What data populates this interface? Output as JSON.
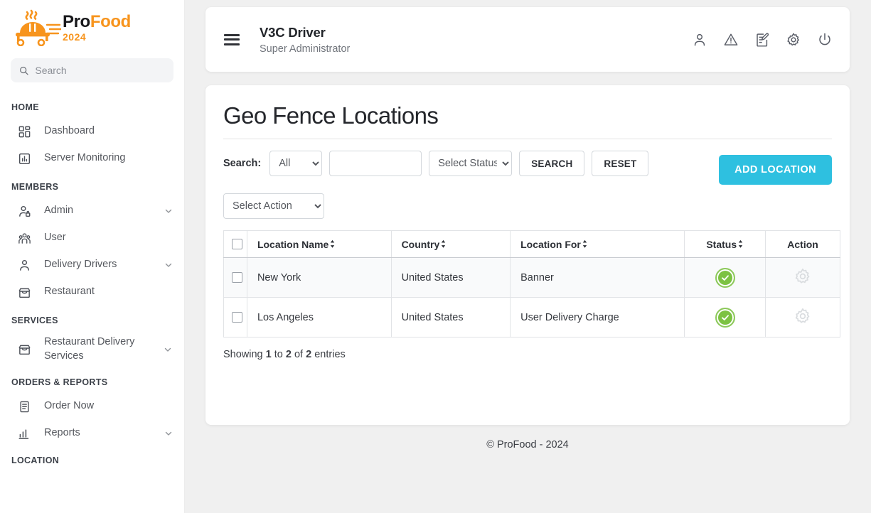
{
  "brand": {
    "name_part1": "Pro",
    "name_part2": "Food",
    "year": "2024",
    "accent_orange": "#f7941d",
    "accent_blue": "#2ec0e0",
    "status_green": "#7cc242"
  },
  "sidebar": {
    "search": {
      "placeholder": "Search",
      "value": "",
      "icon": "search-icon"
    },
    "groups": [
      {
        "section": "HOME",
        "items": [
          {
            "label": "Dashboard",
            "icon": "dashboard-grid-icon",
            "chevron": false
          },
          {
            "label": "Server Monitoring",
            "icon": "bar-chart-icon",
            "chevron": false
          }
        ]
      },
      {
        "section": "MEMBERS",
        "items": [
          {
            "label": "Admin",
            "icon": "user-lock-icon",
            "chevron": true
          },
          {
            "label": "User",
            "icon": "users-group-icon",
            "chevron": false
          },
          {
            "label": "Delivery Drivers",
            "icon": "person-icon",
            "chevron": true
          },
          {
            "label": "Restaurant",
            "icon": "storefront-icon",
            "chevron": false
          }
        ]
      },
      {
        "section": "SERVICES",
        "items": [
          {
            "label": "Restaurant Delivery Services",
            "icon": "storefront-icon",
            "chevron": true
          }
        ]
      },
      {
        "section": "ORDERS & REPORTS",
        "items": [
          {
            "label": "Order Now",
            "icon": "document-list-icon",
            "chevron": false
          },
          {
            "label": "Reports",
            "icon": "bar-chart-up-icon",
            "chevron": true
          }
        ]
      },
      {
        "section": "LOCATION",
        "items": []
      }
    ]
  },
  "topbar": {
    "menu_icon": "hamburger-icon",
    "title": "V3C Driver",
    "subtitle": "Super Administrator",
    "icons": [
      {
        "name": "profile-icon"
      },
      {
        "name": "alert-triangle-icon"
      },
      {
        "name": "edit-document-icon"
      },
      {
        "name": "settings-gear-icon"
      },
      {
        "name": "power-icon"
      }
    ]
  },
  "page": {
    "title": "Geo Fence Locations",
    "filters": {
      "search_label": "Search:",
      "scope_selected": "All",
      "scope_options": [
        "All"
      ],
      "keyword_value": "",
      "keyword_placeholder": "",
      "status_selected": "Select Status",
      "status_options": [
        "Select Status"
      ],
      "search_button": "SEARCH",
      "reset_button": "RESET",
      "add_button": "ADD LOCATION"
    },
    "bulk_action": {
      "selected": "Select Action",
      "options": [
        "Select Action"
      ]
    },
    "table": {
      "columns": [
        {
          "label": "",
          "key": "check",
          "sortable": false
        },
        {
          "label": "Location Name",
          "key": "name",
          "sortable": true
        },
        {
          "label": "Country",
          "key": "country",
          "sortable": true
        },
        {
          "label": "Location For",
          "key": "location_for",
          "sortable": true
        },
        {
          "label": "Status",
          "key": "status",
          "sortable": true
        },
        {
          "label": "Action",
          "key": "action",
          "sortable": false
        }
      ],
      "rows": [
        {
          "checked": false,
          "name": "New York",
          "country": "United States",
          "location_for": "Banner",
          "status": "active",
          "action_icon": "gear-icon"
        },
        {
          "checked": false,
          "name": "Los Angeles",
          "country": "United States",
          "location_for": "User Delivery Charge",
          "status": "active",
          "action_icon": "gear-icon"
        }
      ]
    },
    "showing": {
      "prefix": "Showing ",
      "from": "1",
      "mid1": " to ",
      "to": "2",
      "mid2": " of ",
      "total": "2",
      "suffix": " entries"
    }
  },
  "footer": {
    "text": "© ProFood - 2024"
  }
}
